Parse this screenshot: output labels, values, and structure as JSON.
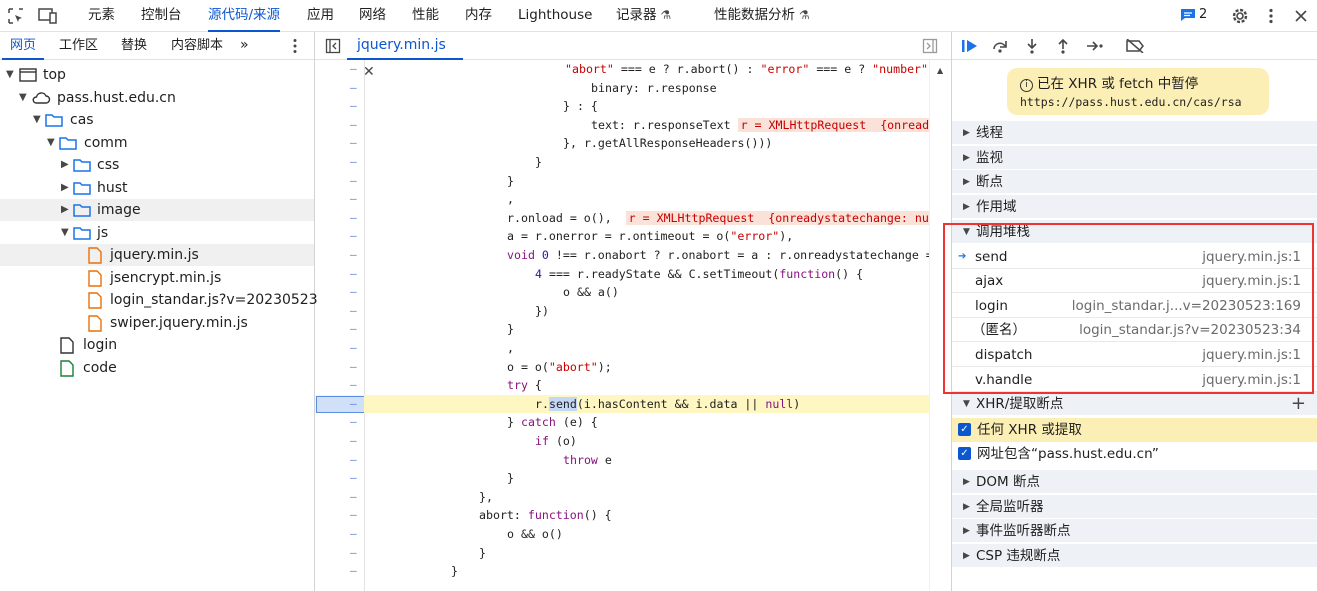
{
  "topbar": {
    "tabs": [
      "元素",
      "控制台",
      "源代码/来源",
      "应用",
      "网络",
      "性能",
      "内存",
      "Lighthouse",
      "记录器",
      "性能数据分析"
    ],
    "active_tab": "源代码/来源",
    "issues_count": "2"
  },
  "navigator": {
    "tabs": [
      "网页",
      "工作区",
      "替换",
      "内容脚本"
    ],
    "active_tab": "网页",
    "tree": [
      {
        "label": "top",
        "icon": "frame-icon"
      },
      {
        "label": "pass.hust.edu.cn",
        "icon": "cloud-icon"
      },
      {
        "label": "cas",
        "icon": "folder-icon"
      },
      {
        "label": "comm",
        "icon": "folder-icon"
      },
      {
        "label": "css",
        "icon": "folder-icon"
      },
      {
        "label": "hust",
        "icon": "folder-icon"
      },
      {
        "label": "image",
        "icon": "folder-icon"
      },
      {
        "label": "js",
        "icon": "folder-icon"
      },
      {
        "label": "jquery.min.js",
        "icon": "script-file-icon"
      },
      {
        "label": "jsencrypt.min.js",
        "icon": "script-file-icon"
      },
      {
        "label": "login_standar.js?v=20230523",
        "icon": "script-file-icon"
      },
      {
        "label": "swiper.jquery.min.js",
        "icon": "script-file-icon"
      },
      {
        "label": "login",
        "icon": "document-icon"
      },
      {
        "label": "code",
        "icon": "document-icon"
      }
    ]
  },
  "editor": {
    "file_tab": "jquery.min.js"
  },
  "debugger": {
    "paused_title": "已在 XHR 或 fetch 中暂停",
    "paused_url": "https://pass.hust.edu.cn/cas/rsa",
    "sections_top": [
      "线程",
      "监视",
      "断点",
      "作用域"
    ],
    "call_stack_title": "调用堆栈",
    "call_stack": [
      {
        "fn": "send",
        "loc": "jquery.min.js:1"
      },
      {
        "fn": "ajax",
        "loc": "jquery.min.js:1"
      },
      {
        "fn": "login",
        "loc": "login_standar.j...v=20230523:169"
      },
      {
        "fn": "（匿名）",
        "loc": "login_standar.js?v=20230523:34"
      },
      {
        "fn": "dispatch",
        "loc": "jquery.min.js:1"
      },
      {
        "fn": "v.handle",
        "loc": "jquery.min.js:1"
      }
    ],
    "xhr_title": "XHR/提取断点",
    "xhr_items": [
      "任何 XHR 或提取",
      "网址包含“pass.hust.edu.cn”"
    ],
    "sections_bottom": [
      "DOM 断点",
      "全局监听器",
      "事件监听器断点",
      "CSP 违规断点"
    ]
  }
}
